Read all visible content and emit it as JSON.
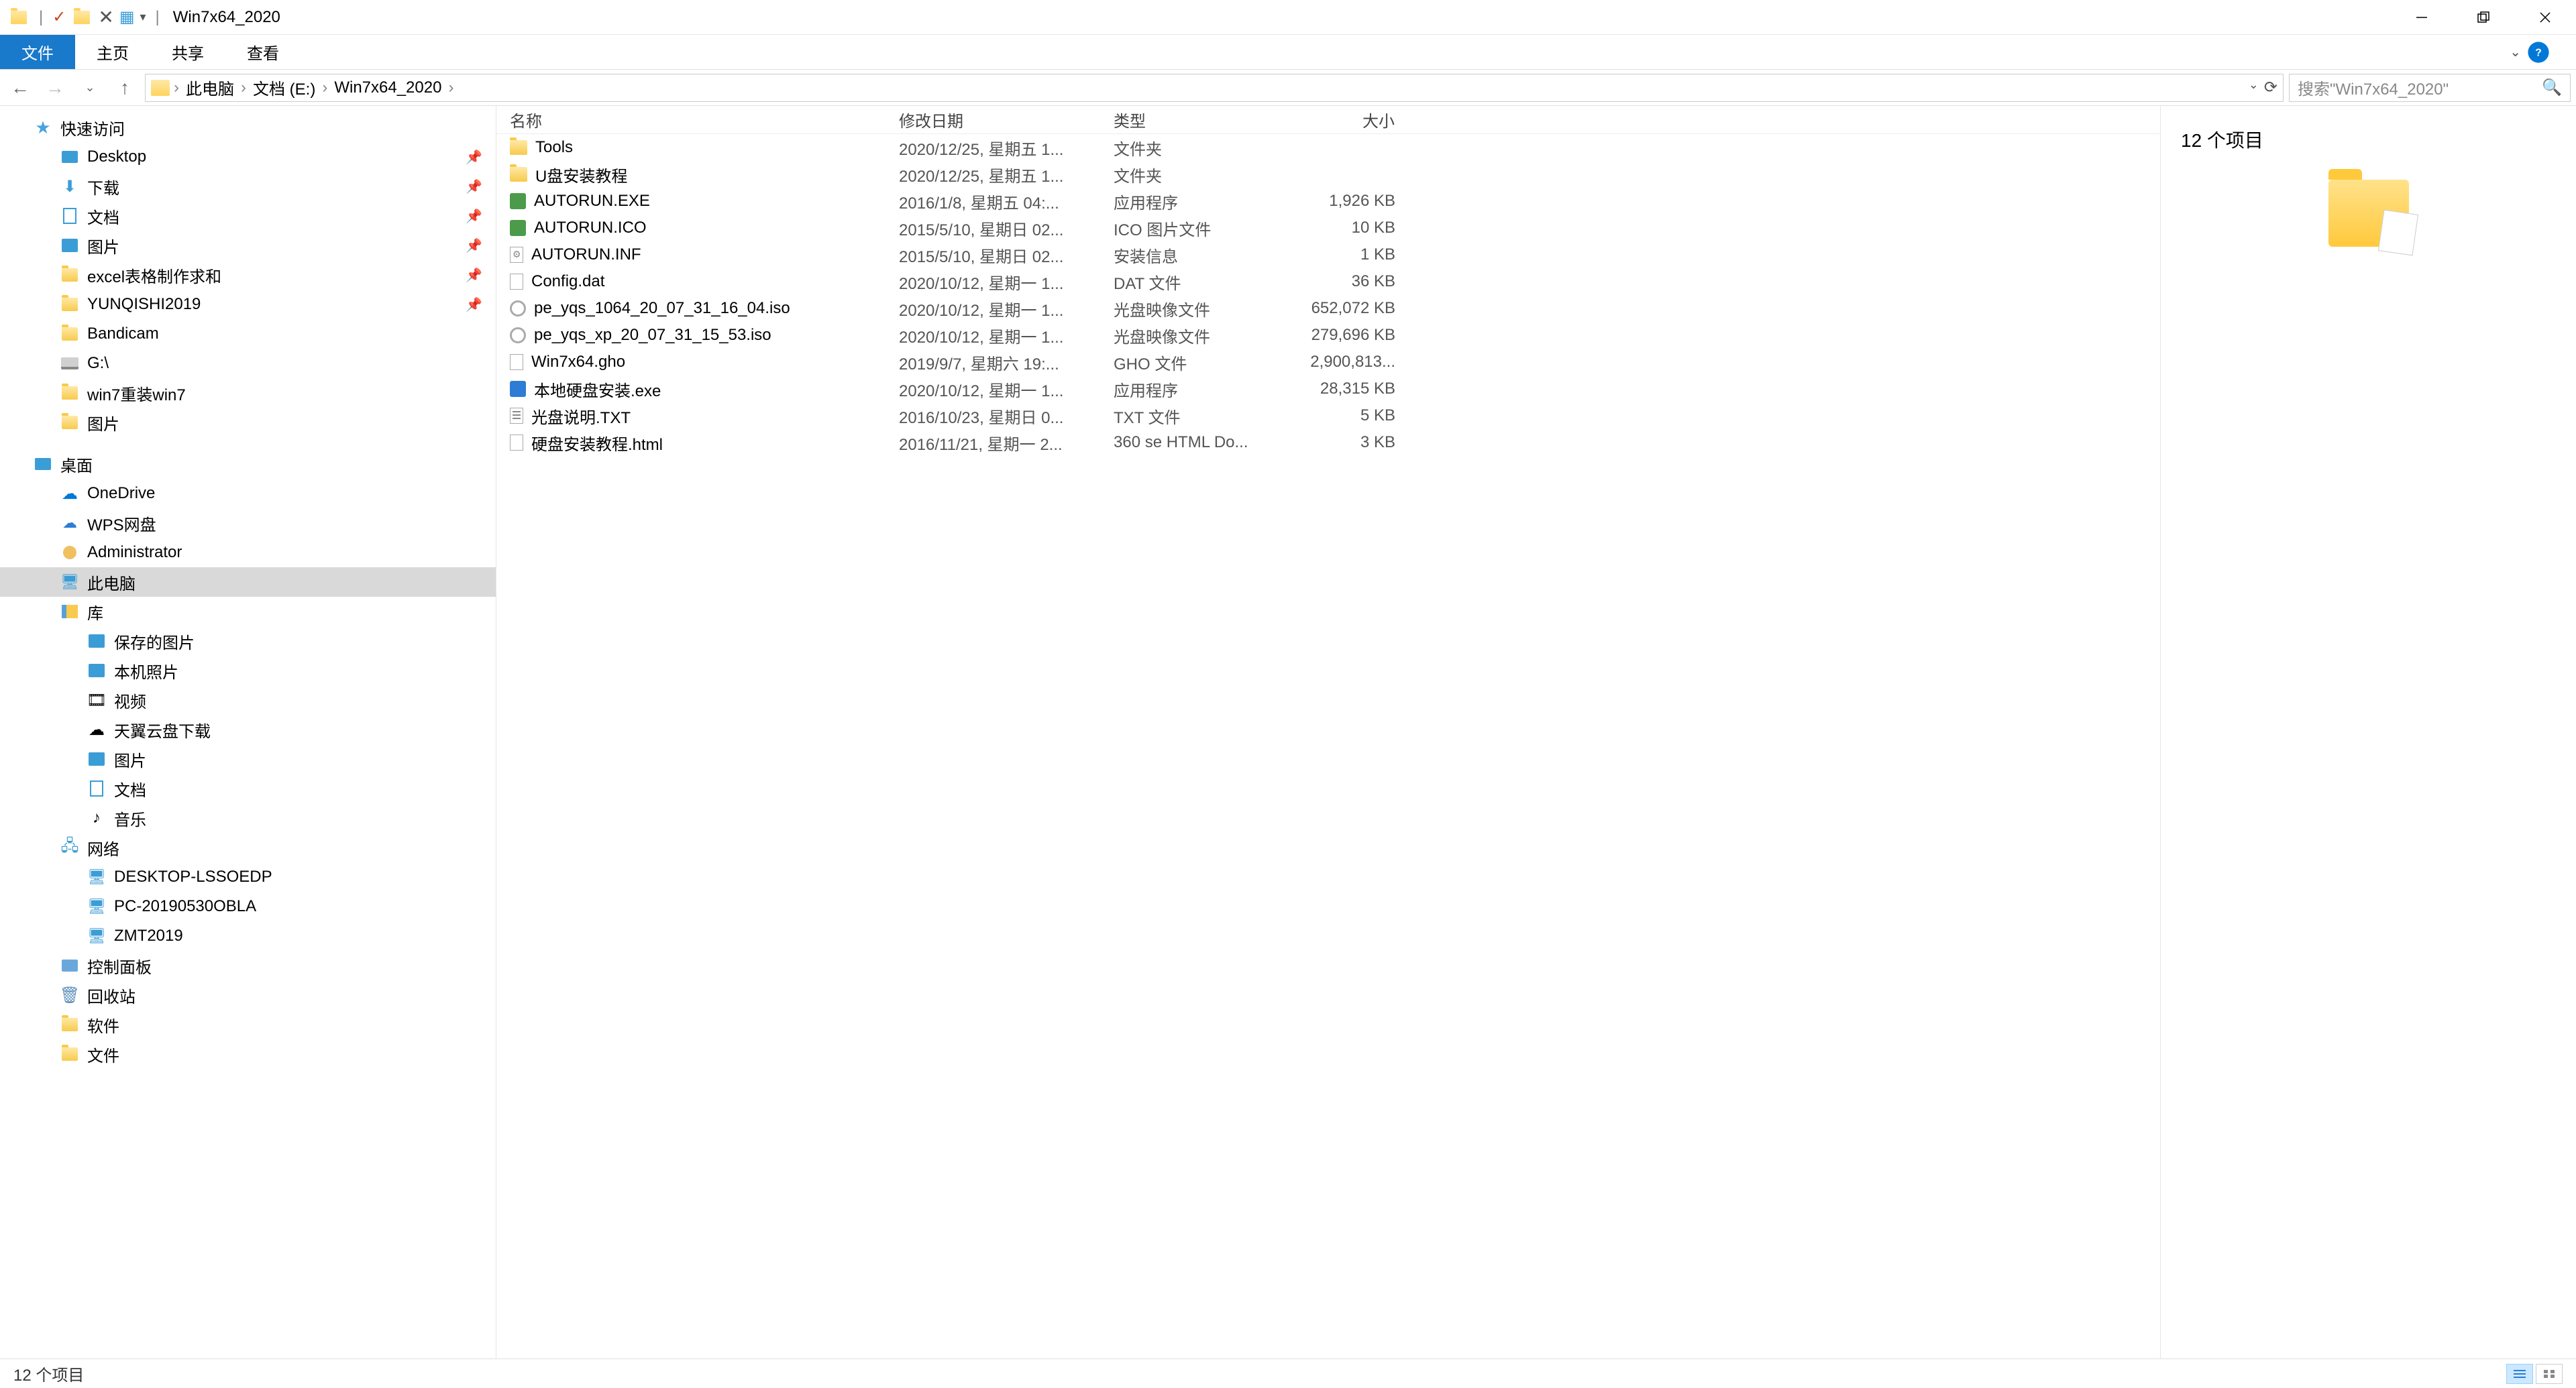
{
  "window": {
    "title": "Win7x64_2020"
  },
  "ribbon": {
    "file": "文件",
    "home": "主页",
    "share": "共享",
    "view": "查看"
  },
  "breadcrumb": {
    "items": [
      "此电脑",
      "文档 (E:)",
      "Win7x64_2020"
    ]
  },
  "search": {
    "placeholder": "搜索\"Win7x64_2020\""
  },
  "tree": {
    "quick_access": "快速访问",
    "desktop": "Desktop",
    "downloads": "下载",
    "documents": "文档",
    "pictures": "图片",
    "excel": "excel表格制作求和",
    "yunqishi": "YUNQISHI2019",
    "bandicam": "Bandicam",
    "gdrive": "G:\\",
    "win7reinstall": "win7重装win7",
    "pictures2": "图片",
    "desktop_root": "桌面",
    "onedrive": "OneDrive",
    "wps": "WPS网盘",
    "admin": "Administrator",
    "thispc": "此电脑",
    "libraries": "库",
    "saved_pics": "保存的图片",
    "camera_roll": "本机照片",
    "videos": "视频",
    "tianyi": "天翼云盘下载",
    "lib_pics": "图片",
    "lib_docs": "文档",
    "lib_music": "音乐",
    "network": "网络",
    "desktop_lssoedp": "DESKTOP-LSSOEDP",
    "pc2019": "PC-20190530OBLA",
    "zmt2019": "ZMT2019",
    "control_panel": "控制面板",
    "recycle": "回收站",
    "software": "软件",
    "files": "文件"
  },
  "columns": {
    "name": "名称",
    "date": "修改日期",
    "type": "类型",
    "size": "大小"
  },
  "files": [
    {
      "icon": "folder",
      "name": "Tools",
      "date": "2020/12/25, 星期五 1...",
      "type": "文件夹",
      "size": ""
    },
    {
      "icon": "folder",
      "name": "U盘安装教程",
      "date": "2020/12/25, 星期五 1...",
      "type": "文件夹",
      "size": ""
    },
    {
      "icon": "exe",
      "name": "AUTORUN.EXE",
      "date": "2016/1/8, 星期五 04:...",
      "type": "应用程序",
      "size": "1,926 KB"
    },
    {
      "icon": "ico",
      "name": "AUTORUN.ICO",
      "date": "2015/5/10, 星期日 02...",
      "type": "ICO 图片文件",
      "size": "10 KB"
    },
    {
      "icon": "inf",
      "name": "AUTORUN.INF",
      "date": "2015/5/10, 星期日 02...",
      "type": "安装信息",
      "size": "1 KB"
    },
    {
      "icon": "dat",
      "name": "Config.dat",
      "date": "2020/10/12, 星期一 1...",
      "type": "DAT 文件",
      "size": "36 KB"
    },
    {
      "icon": "iso",
      "name": "pe_yqs_1064_20_07_31_16_04.iso",
      "date": "2020/10/12, 星期一 1...",
      "type": "光盘映像文件",
      "size": "652,072 KB"
    },
    {
      "icon": "iso",
      "name": "pe_yqs_xp_20_07_31_15_53.iso",
      "date": "2020/10/12, 星期一 1...",
      "type": "光盘映像文件",
      "size": "279,696 KB"
    },
    {
      "icon": "gho",
      "name": "Win7x64.gho",
      "date": "2019/9/7, 星期六 19:...",
      "type": "GHO 文件",
      "size": "2,900,813..."
    },
    {
      "icon": "exe2",
      "name": "本地硬盘安装.exe",
      "date": "2020/10/12, 星期一 1...",
      "type": "应用程序",
      "size": "28,315 KB"
    },
    {
      "icon": "txt",
      "name": "光盘说明.TXT",
      "date": "2016/10/23, 星期日 0...",
      "type": "TXT 文件",
      "size": "5 KB"
    },
    {
      "icon": "html",
      "name": "硬盘安装教程.html",
      "date": "2016/11/21, 星期一 2...",
      "type": "360 se HTML Do...",
      "size": "3 KB"
    }
  ],
  "preview": {
    "title": "12 个项目"
  },
  "status": {
    "text": "12 个项目"
  }
}
